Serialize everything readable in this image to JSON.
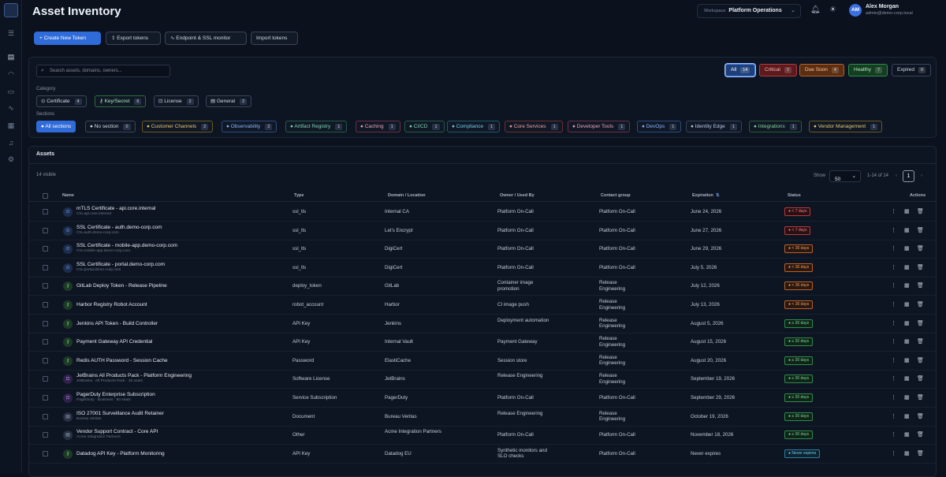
{
  "header": {
    "title": "Asset Inventory",
    "workspace_label": "Workspace",
    "workspace_value": "Platform Operations",
    "user_initials": "AM",
    "user_name": "Alex Morgan",
    "user_email": "admin@demo-corp.local"
  },
  "toolbar": {
    "create": "Create New Token",
    "export": "Export tokens",
    "monitor": "Endpoint & SSL monitor",
    "import": "Import tokens"
  },
  "filters": {
    "search_placeholder": "Search assets, domains, owners...",
    "status": [
      {
        "label": "All",
        "count": "14"
      },
      {
        "label": "Critical",
        "count": "2"
      },
      {
        "label": "Due Soon",
        "count": "4"
      },
      {
        "label": "Healthy",
        "count": "7"
      },
      {
        "label": "Expired",
        "count": "0"
      }
    ],
    "category_label": "Category",
    "categories": [
      {
        "label": "Certificate",
        "count": "4"
      },
      {
        "label": "Key/Secret",
        "count": "6"
      },
      {
        "label": "License",
        "count": "2"
      },
      {
        "label": "General",
        "count": "2"
      }
    ],
    "sections_label": "Sections",
    "sections": [
      {
        "label": "All sections",
        "count": ""
      },
      {
        "label": "No section",
        "count": "0"
      },
      {
        "label": "Customer Channels",
        "count": "2"
      },
      {
        "label": "Observability",
        "count": "2"
      },
      {
        "label": "Artifact Registry",
        "count": "1"
      },
      {
        "label": "Caching",
        "count": "1"
      },
      {
        "label": "CI/CD",
        "count": "1"
      },
      {
        "label": "Compliance",
        "count": "1"
      },
      {
        "label": "Core Services",
        "count": "1"
      },
      {
        "label": "Developer Tools",
        "count": "1"
      },
      {
        "label": "DevOps",
        "count": "1"
      },
      {
        "label": "Identity Edge",
        "count": "1"
      },
      {
        "label": "Integrations",
        "count": "1"
      },
      {
        "label": "Vendor Management",
        "count": "1"
      }
    ]
  },
  "assets": {
    "title": "Assets",
    "visible": "14 visible",
    "show_label": "Show",
    "page_size": "50",
    "range": "1-14 of 14",
    "page": "1",
    "columns": {
      "name": "Name",
      "type": "Type",
      "domain": "Domain / Location",
      "owner": "Owner / Used By",
      "contact": "Contact group",
      "expiration": "Expiration",
      "status": "Status",
      "actions": "Actions"
    },
    "rows": [
      {
        "icon": "cert",
        "name": "mTLS Certificate - api.core.internal",
        "sub": "CN=api.core.internal",
        "type": "ssl_tls",
        "domain": "Internal CA",
        "owner": "Platform On-Call",
        "contact": "Platform On-Call",
        "expiration": "June 24, 2026",
        "status": "< 7 days",
        "tone": "red"
      },
      {
        "icon": "cert",
        "name": "SSL Certificate - auth.demo-corp.com",
        "sub": "CN=auth.demo-corp.com",
        "type": "ssl_tls",
        "domain": "Let's Encrypt",
        "owner": "Platform On-Call",
        "contact": "Platform On-Call",
        "expiration": "June 27, 2026",
        "status": "< 7 days",
        "tone": "red"
      },
      {
        "icon": "cert",
        "name": "SSL Certificate - mobile-app.demo-corp.com",
        "sub": "CN=mobile-app.demo-corp.com",
        "type": "ssl_tls",
        "domain": "DigiCert",
        "owner": "Platform On-Call",
        "contact": "Platform On-Call",
        "expiration": "June 29, 2026",
        "status": "< 30 days",
        "tone": "orange"
      },
      {
        "icon": "cert",
        "name": "SSL Certificate - portal.demo-corp.com",
        "sub": "CN=portal.demo-corp.com",
        "type": "ssl_tls",
        "domain": "DigiCert",
        "owner": "Platform On-Call",
        "contact": "Platform On-Call",
        "expiration": "July 5, 2026",
        "status": "< 30 days",
        "tone": "orange"
      },
      {
        "icon": "key",
        "name": "GitLab Deploy Token - Release Pipeline",
        "sub": "",
        "type": "deploy_token",
        "domain": "GitLab",
        "owner": "Container image promotion",
        "contact": "Release Engineering",
        "expiration": "July 12, 2026",
        "status": "< 30 days",
        "tone": "orange"
      },
      {
        "icon": "key",
        "name": "Harbor Registry Robot Account",
        "sub": "",
        "type": "robot_account",
        "domain": "Harbor",
        "owner": "CI image push",
        "contact": "Release Engineering",
        "expiration": "July 13, 2026",
        "status": "< 30 days",
        "tone": "orange"
      },
      {
        "icon": "key",
        "name": "Jenkins API Token - Build Controller",
        "sub": "",
        "type": "API Key",
        "domain": "Jenkins",
        "owner": "Deployment automation",
        "contact": "Release Engineering",
        "expiration": "August 5, 2026",
        "status": "≥ 30 days",
        "tone": "green"
      },
      {
        "icon": "key",
        "name": "Payment Gateway API Credential",
        "sub": "",
        "type": "API Key",
        "domain": "Internal Vault",
        "owner": "Payment Gateway",
        "contact": "Release Engineering",
        "expiration": "August 15, 2026",
        "status": "≥ 30 days",
        "tone": "green"
      },
      {
        "icon": "key",
        "name": "Redis AUTH Password - Session Cache",
        "sub": "",
        "type": "Password",
        "domain": "ElastiCache",
        "owner": "Session store",
        "contact": "Release Engineering",
        "expiration": "August 20, 2026",
        "status": "≥ 30 days",
        "tone": "green"
      },
      {
        "icon": "lic",
        "name": "JetBrains All Products Pack - Platform Engineering",
        "sub": "JetBrains · All Products Pack · 45 seats",
        "type": "Software License",
        "domain": "JetBrains",
        "owner": "Release Engineering",
        "contact": "Release Engineering",
        "expiration": "September 19, 2026",
        "status": "≥ 30 days",
        "tone": "green"
      },
      {
        "icon": "lic",
        "name": "PagerDuty Enterprise Subscription",
        "sub": "PagerDuty · Business · 80 seats",
        "type": "Service Subscription",
        "domain": "PagerDuty",
        "owner": "Platform On-Call",
        "contact": "Platform On-Call",
        "expiration": "September 29, 2026",
        "status": "≥ 30 days",
        "tone": "green"
      },
      {
        "icon": "gen",
        "name": "ISO 27001 Surveillance Audit Retainer",
        "sub": "Bureau Veritas",
        "type": "Document",
        "domain": "Bureau Veritas",
        "owner": "Release Engineering",
        "contact": "Release Engineering",
        "expiration": "October 19, 2026",
        "status": "≥ 30 days",
        "tone": "green"
      },
      {
        "icon": "gen",
        "name": "Vendor Support Contract - Core API",
        "sub": "Acme Integration Partners",
        "type": "Other",
        "domain": "Acme Integration Partners",
        "owner": "Platform On-Call",
        "contact": "Platform On-Call",
        "expiration": "November 18, 2026",
        "status": "≥ 30 days",
        "tone": "green"
      },
      {
        "icon": "key",
        "name": "Datadog API Key - Platform Monitoring",
        "sub": "",
        "type": "API Key",
        "domain": "Datadog EU",
        "owner": "Synthetic monitors and SLO checks",
        "contact": "Platform On-Call",
        "expiration": "Never expires",
        "status": "Never expires",
        "tone": "blue"
      }
    ]
  }
}
